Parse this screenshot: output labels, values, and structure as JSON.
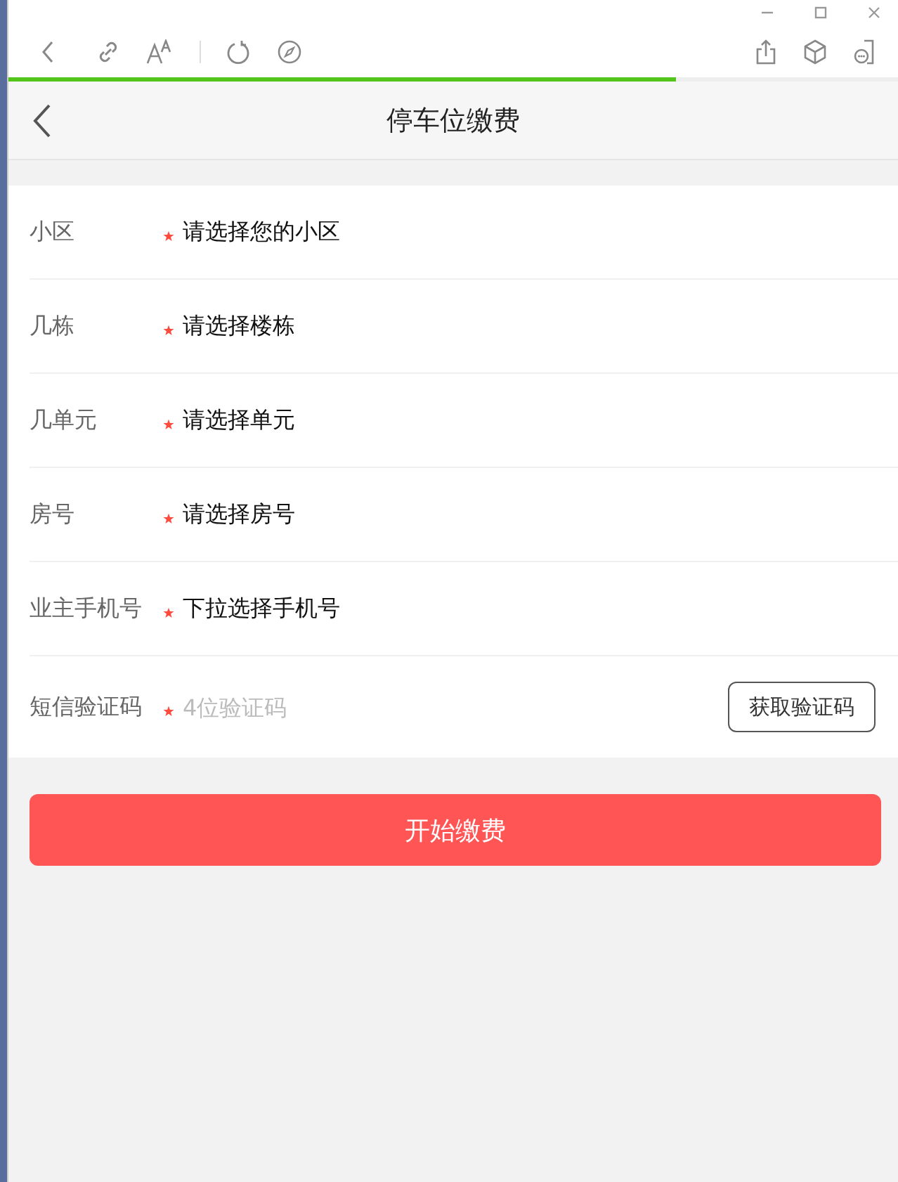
{
  "browser": {
    "progress": {
      "level": 0.75
    }
  },
  "header": {
    "title": "停车位缴费"
  },
  "form": {
    "rows": [
      {
        "kind": "select",
        "label": "小区",
        "required": true,
        "value": "请选择您的小区"
      },
      {
        "kind": "select",
        "label": "几栋",
        "required": true,
        "value": "请选择楼栋"
      },
      {
        "kind": "select",
        "label": "几单元",
        "required": true,
        "value": "请选择单元"
      },
      {
        "kind": "select",
        "label": "房号",
        "required": true,
        "value": "请选择房号"
      },
      {
        "kind": "select",
        "label": "业主手机号",
        "required": true,
        "value": "下拉选择手机号"
      },
      {
        "kind": "code",
        "label": "短信验证码",
        "required": true,
        "placeholder": "4位验证码",
        "button": "获取验证码"
      }
    ]
  },
  "submit": "开始缴费"
}
